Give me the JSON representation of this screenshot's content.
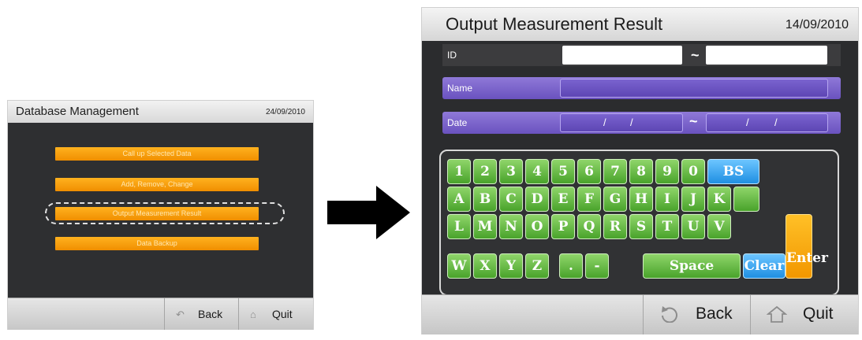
{
  "left_screen": {
    "title": "Database Management",
    "date": "24/09/2010",
    "menu": [
      "Call up Selected Data",
      "Add, Remove, Change",
      "Output Measurement Result",
      "Data Backup"
    ],
    "footer": {
      "back": "Back",
      "quit": "Quit",
      "back_icon": "back-arrow-icon",
      "quit_icon": "home-icon"
    }
  },
  "right_screen": {
    "title": "Output Measurement Result",
    "date": "14/09/2010",
    "fields": {
      "id_label": "ID",
      "name_label": "Name",
      "date_label": "Date",
      "range_separator": "~",
      "date_separator": "/"
    },
    "keypad": {
      "row1": [
        "1",
        "2",
        "3",
        "4",
        "5",
        "6",
        "7",
        "8",
        "9",
        "0"
      ],
      "row2": [
        "A",
        "B",
        "C",
        "D",
        "E",
        "F",
        "G",
        "H",
        "I",
        "J",
        "K"
      ],
      "row3": [
        "L",
        "M",
        "N",
        "O",
        "P",
        "Q",
        "R",
        "S",
        "T",
        "U",
        "V"
      ],
      "row4": [
        "W",
        "X",
        "Y",
        "Z",
        ".",
        "-"
      ],
      "backspace": "BS",
      "space": "Space",
      "clear": "Clear",
      "enter": "Enter"
    },
    "footer": {
      "back": "Back",
      "quit": "Quit",
      "back_icon": "back-arrow-icon",
      "quit_icon": "home-icon"
    }
  },
  "colors": {
    "accent_orange": "#f39a00",
    "key_green": "#5cb33a",
    "key_blue": "#2b9be8",
    "field_purple": "#6a52bf"
  }
}
